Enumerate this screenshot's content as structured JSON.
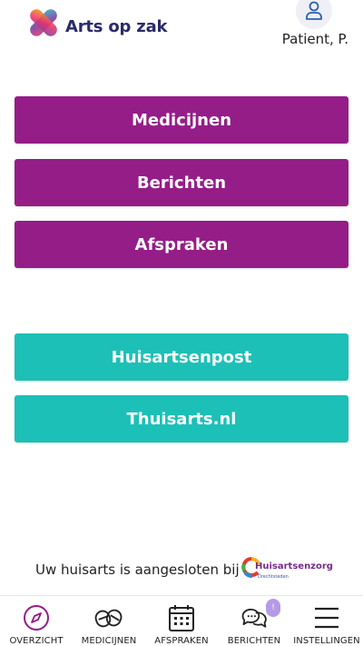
{
  "header": {
    "app_name": "Arts op zak",
    "user_name": "Patient, P."
  },
  "menu": {
    "medicijnen": "Medicijnen",
    "berichten": "Berichten",
    "afspraken": "Afspraken",
    "huisartsenpost": "Huisartsenpost",
    "thuisarts": "Thuisarts.nl"
  },
  "footer": {
    "aangesloten_text": "Uw huisarts is aangesloten bij",
    "partner_title": "Huisartsenzorg",
    "partner_subtitle": "Drechtsteden"
  },
  "tabbar": {
    "overzicht": "OVERZICHT",
    "medicijnen": "MEDICIJNEN",
    "afspraken": "AFSPRAKEN",
    "berichten": "BERICHTEN",
    "berichten_badge": "!",
    "instellingen": "INSTELLINGEN"
  },
  "colors": {
    "primary_purple": "#951d88",
    "teal": "#1dc0b6",
    "brand_navy": "#2b2a6b"
  },
  "icons": [
    "app-logo-icon",
    "user-icon",
    "compass-icon",
    "pills-icon",
    "calendar-icon",
    "chat-bubbles-icon",
    "menu-icon"
  ]
}
